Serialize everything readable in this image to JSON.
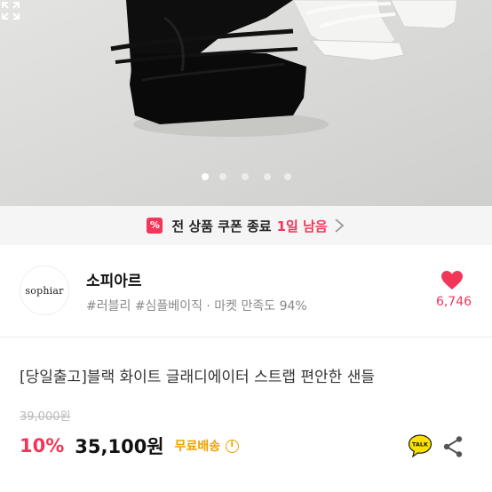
{
  "product_image": {
    "alt_subject": "sandals",
    "slide_count": 5,
    "active_slide": 1
  },
  "coupon_banner": {
    "icon_glyph": "%",
    "text": "전 상품 쿠폰 종료",
    "accent": "1일 남음"
  },
  "shop": {
    "logo_text": "sophiar",
    "name": "소피아르",
    "meta": "#러블리 #심플베이직 · 마켓 만족도 94%",
    "likes": "6,746"
  },
  "product": {
    "title": "[당일출고]블랙 화이트 글래디에이터 스트랩 편안한 샌들",
    "original_price": "39,000원",
    "discount": "10%",
    "price": "35,100원",
    "shipping": "무료배송",
    "info_glyph": "i"
  },
  "actions": {
    "talk_label": "TALK"
  },
  "colors": {
    "accent": "#f2365a",
    "shipping": "#f0a000",
    "talk_bubble": "#fae100"
  },
  "icons": [
    "coupon-icon",
    "chevron-right-icon",
    "expand-icon",
    "heart-icon",
    "info-icon",
    "kakao-talk-icon",
    "share-icon"
  ]
}
